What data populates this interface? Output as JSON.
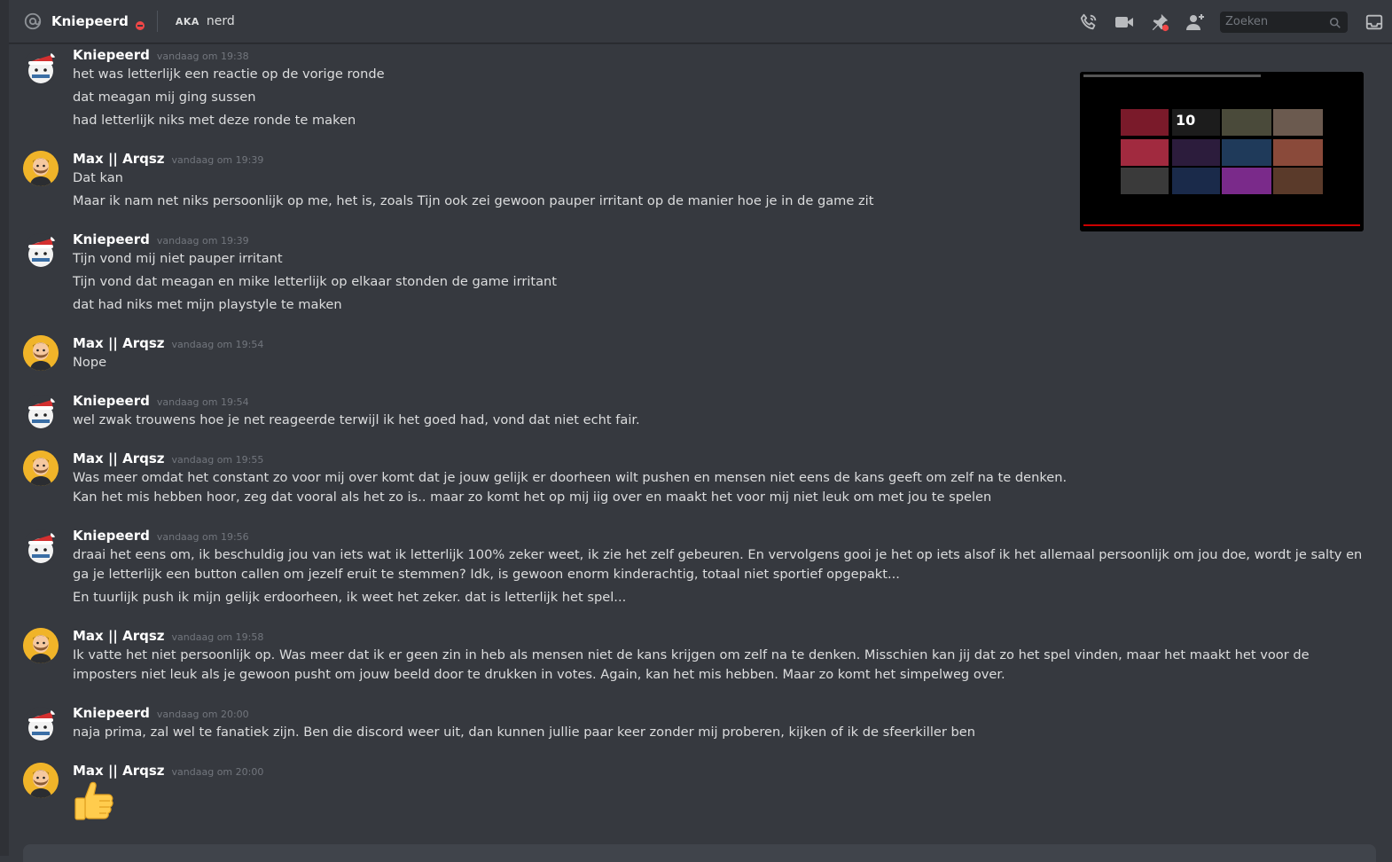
{
  "header": {
    "title": "Kniepeerd",
    "aka_label": "AKA",
    "aka_name": "nerd",
    "search_placeholder": "Zoeken",
    "icons": [
      "at-icon",
      "dnd-status-icon",
      "call-icon",
      "video-icon",
      "pin-icon",
      "add-friend-icon",
      "search-icon",
      "inbox-icon"
    ]
  },
  "users": {
    "kniepeerd": "Kniepeerd",
    "max": "Max || Arqsz"
  },
  "messages": [
    {
      "author": "Kniepeerd",
      "timestamp": "vandaag om 19:38",
      "lines": [
        "het was letterlijk een reactie op de vorige ronde",
        "dat meagan mij ging sussen",
        "had letterlijk niks met deze ronde te maken"
      ]
    },
    {
      "author": "Max || Arqsz",
      "timestamp": "vandaag om 19:39",
      "lines": [
        "Dat kan",
        "Maar ik nam net niks persoonlijk op me, het is, zoals Tijn ook zei gewoon pauper irritant op de manier hoe je in de game zit"
      ]
    },
    {
      "author": "Kniepeerd",
      "timestamp": "vandaag om 19:39",
      "lines": [
        "Tijn vond mij niet pauper irritant",
        "Tijn vond dat meagan en mike letterlijk op elkaar stonden de game irritant",
        "dat had niks met mijn playstyle te maken"
      ]
    },
    {
      "author": "Max || Arqsz",
      "timestamp": "vandaag om 19:54",
      "lines": [
        "Nope"
      ]
    },
    {
      "author": "Kniepeerd",
      "timestamp": "vandaag om 19:54",
      "lines": [
        "wel zwak trouwens hoe je net reageerde terwijl ik het goed had, vond dat niet echt fair."
      ]
    },
    {
      "author": "Max || Arqsz",
      "timestamp": "vandaag om 19:55",
      "lines": [
        "Was meer omdat het constant zo voor mij over komt dat je jouw gelijk er doorheen wilt pushen en mensen niet eens de kans geeft om zelf na te denken.",
        "Kan het mis hebben hoor, zeg dat vooral als het zo is.. maar zo komt het op mij iig over en maakt het voor mij niet leuk om met jou te spelen"
      ]
    },
    {
      "author": "Kniepeerd",
      "timestamp": "vandaag om 19:56",
      "lines": [
        "draai het eens om, ik beschuldig jou van iets wat ik letterlijk 100% zeker weet, ik zie het zelf gebeuren. En vervolgens gooi je het op iets alsof ik het allemaal persoonlijk om jou doe, wordt je salty en ga je letterlijk een button callen om jezelf eruit te stemmen? Idk, is gewoon enorm kinderachtig, totaal niet sportief opgepakt...",
        "En tuurlijk push ik mijn gelijk erdoorheen, ik weet het zeker. dat is letterlijk het spel..."
      ]
    },
    {
      "author": "Max || Arqsz",
      "timestamp": "vandaag om 19:58",
      "lines": [
        "Ik vatte het niet persoonlijk op. Was meer dat ik er geen zin in heb als mensen niet de kans krijgen om zelf na te denken. Misschien kan jij dat zo het spel vinden, maar het maakt het voor de imposters niet leuk als je gewoon pusht om jouw beeld door te drukken in votes. Again, kan het mis hebben. Maar zo komt het simpelweg over."
      ]
    },
    {
      "author": "Kniepeerd",
      "timestamp": "vandaag om 20:00",
      "lines": [
        "naja prima, zal wel te fanatiek zijn. Ben die discord weer uit, dan kunnen jullie paar keer zonder mij proberen, kijken of ik de sfeerkiller ben"
      ]
    },
    {
      "author": "Max || Arqsz",
      "timestamp": "vandaag om 20:00",
      "lines": [],
      "emoji": "thumbs-up"
    }
  ],
  "embed": {
    "type": "video-thumbnail-grid",
    "overlay_text": "10"
  },
  "colors": {
    "background": "#36393f",
    "username": "#ffffff",
    "timestamp": "#72767d",
    "text": "#dcddde",
    "dnd": "#f04747"
  }
}
